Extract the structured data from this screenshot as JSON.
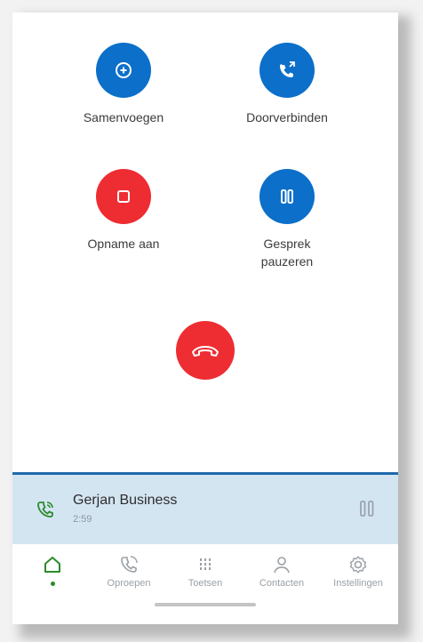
{
  "actions": {
    "merge_label": "Samenvoegen",
    "transfer_label": "Doorverbinden",
    "record_label": "Opname aan",
    "hold_label_line1": "Gesprek",
    "hold_label_line2": "pauzeren"
  },
  "active_call": {
    "name": "Gerjan Business",
    "duration": "2:59"
  },
  "nav": {
    "home_label": "",
    "calls_label": "Oproepen",
    "keypad_label": "Toetsen",
    "contacts_label": "Contacten",
    "settings_label": "Instellingen"
  },
  "colors": {
    "blue": "#0c6fc9",
    "red": "#ee2d33",
    "green": "#2d8a2d",
    "call_bar": "#d4e5f2"
  }
}
